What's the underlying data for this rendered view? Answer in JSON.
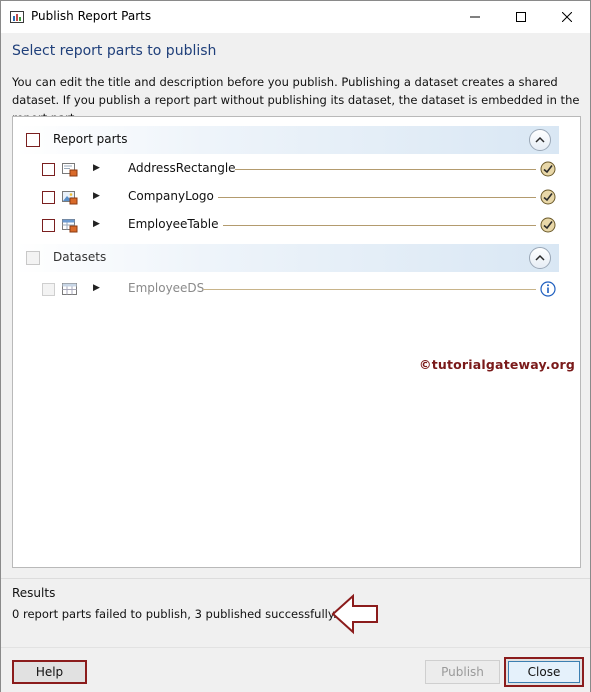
{
  "window": {
    "title": "Publish Report Parts",
    "controls": {
      "minimize_icon": "minimize-icon",
      "maximize_icon": "maximize-icon",
      "close_icon": "close-icon"
    }
  },
  "heading": "Select report parts to publish",
  "intro": "You can edit the title and description before you publish. Publishing a dataset creates a shared dataset. If you publish a report part without publishing its dataset, the dataset is embedded in the report part.",
  "groups": {
    "report_parts": {
      "label": "Report parts",
      "checked": false,
      "items": [
        {
          "name": "AddressRectangle",
          "checked": false,
          "icon": "rectangle-part-icon",
          "status_icon": "published-check-icon"
        },
        {
          "name": "CompanyLogo",
          "checked": false,
          "icon": "image-part-icon",
          "status_icon": "published-check-icon"
        },
        {
          "name": "EmployeeTable",
          "checked": false,
          "icon": "table-part-icon",
          "status_icon": "published-check-icon"
        }
      ]
    },
    "datasets": {
      "label": "Datasets",
      "checked": false,
      "disabled": true,
      "items": [
        {
          "name": "EmployeeDS",
          "checked": false,
          "icon": "dataset-icon",
          "status_icon": "info-icon"
        }
      ]
    }
  },
  "watermark": "©tutorialgateway.org",
  "results": {
    "label": "Results",
    "text": "0 report parts failed to publish, 3 published successfully."
  },
  "buttons": {
    "help": "Help",
    "publish": "Publish",
    "close": "Close"
  },
  "colors": {
    "accent_red": "#8b1c1c",
    "heading_blue": "#1f3f7a",
    "header_gradient": "#d9e7f4"
  }
}
